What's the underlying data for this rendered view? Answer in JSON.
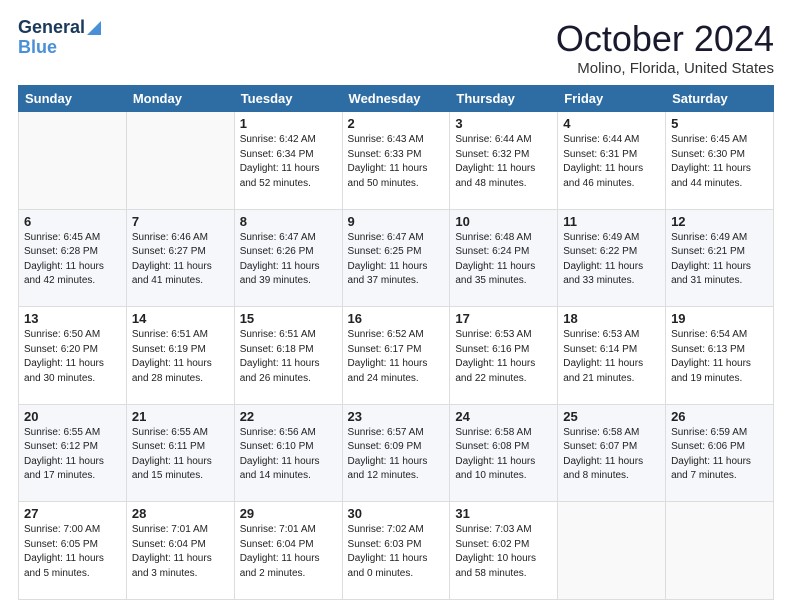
{
  "logo": {
    "line1": "General",
    "line2": "Blue"
  },
  "header": {
    "month": "October 2024",
    "location": "Molino, Florida, United States"
  },
  "weekdays": [
    "Sunday",
    "Monday",
    "Tuesday",
    "Wednesday",
    "Thursday",
    "Friday",
    "Saturday"
  ],
  "weeks": [
    [
      {
        "day": "",
        "info": ""
      },
      {
        "day": "",
        "info": ""
      },
      {
        "day": "1",
        "info": "Sunrise: 6:42 AM\nSunset: 6:34 PM\nDaylight: 11 hours\nand 52 minutes."
      },
      {
        "day": "2",
        "info": "Sunrise: 6:43 AM\nSunset: 6:33 PM\nDaylight: 11 hours\nand 50 minutes."
      },
      {
        "day": "3",
        "info": "Sunrise: 6:44 AM\nSunset: 6:32 PM\nDaylight: 11 hours\nand 48 minutes."
      },
      {
        "day": "4",
        "info": "Sunrise: 6:44 AM\nSunset: 6:31 PM\nDaylight: 11 hours\nand 46 minutes."
      },
      {
        "day": "5",
        "info": "Sunrise: 6:45 AM\nSunset: 6:30 PM\nDaylight: 11 hours\nand 44 minutes."
      }
    ],
    [
      {
        "day": "6",
        "info": "Sunrise: 6:45 AM\nSunset: 6:28 PM\nDaylight: 11 hours\nand 42 minutes."
      },
      {
        "day": "7",
        "info": "Sunrise: 6:46 AM\nSunset: 6:27 PM\nDaylight: 11 hours\nand 41 minutes."
      },
      {
        "day": "8",
        "info": "Sunrise: 6:47 AM\nSunset: 6:26 PM\nDaylight: 11 hours\nand 39 minutes."
      },
      {
        "day": "9",
        "info": "Sunrise: 6:47 AM\nSunset: 6:25 PM\nDaylight: 11 hours\nand 37 minutes."
      },
      {
        "day": "10",
        "info": "Sunrise: 6:48 AM\nSunset: 6:24 PM\nDaylight: 11 hours\nand 35 minutes."
      },
      {
        "day": "11",
        "info": "Sunrise: 6:49 AM\nSunset: 6:22 PM\nDaylight: 11 hours\nand 33 minutes."
      },
      {
        "day": "12",
        "info": "Sunrise: 6:49 AM\nSunset: 6:21 PM\nDaylight: 11 hours\nand 31 minutes."
      }
    ],
    [
      {
        "day": "13",
        "info": "Sunrise: 6:50 AM\nSunset: 6:20 PM\nDaylight: 11 hours\nand 30 minutes."
      },
      {
        "day": "14",
        "info": "Sunrise: 6:51 AM\nSunset: 6:19 PM\nDaylight: 11 hours\nand 28 minutes."
      },
      {
        "day": "15",
        "info": "Sunrise: 6:51 AM\nSunset: 6:18 PM\nDaylight: 11 hours\nand 26 minutes."
      },
      {
        "day": "16",
        "info": "Sunrise: 6:52 AM\nSunset: 6:17 PM\nDaylight: 11 hours\nand 24 minutes."
      },
      {
        "day": "17",
        "info": "Sunrise: 6:53 AM\nSunset: 6:16 PM\nDaylight: 11 hours\nand 22 minutes."
      },
      {
        "day": "18",
        "info": "Sunrise: 6:53 AM\nSunset: 6:14 PM\nDaylight: 11 hours\nand 21 minutes."
      },
      {
        "day": "19",
        "info": "Sunrise: 6:54 AM\nSunset: 6:13 PM\nDaylight: 11 hours\nand 19 minutes."
      }
    ],
    [
      {
        "day": "20",
        "info": "Sunrise: 6:55 AM\nSunset: 6:12 PM\nDaylight: 11 hours\nand 17 minutes."
      },
      {
        "day": "21",
        "info": "Sunrise: 6:55 AM\nSunset: 6:11 PM\nDaylight: 11 hours\nand 15 minutes."
      },
      {
        "day": "22",
        "info": "Sunrise: 6:56 AM\nSunset: 6:10 PM\nDaylight: 11 hours\nand 14 minutes."
      },
      {
        "day": "23",
        "info": "Sunrise: 6:57 AM\nSunset: 6:09 PM\nDaylight: 11 hours\nand 12 minutes."
      },
      {
        "day": "24",
        "info": "Sunrise: 6:58 AM\nSunset: 6:08 PM\nDaylight: 11 hours\nand 10 minutes."
      },
      {
        "day": "25",
        "info": "Sunrise: 6:58 AM\nSunset: 6:07 PM\nDaylight: 11 hours\nand 8 minutes."
      },
      {
        "day": "26",
        "info": "Sunrise: 6:59 AM\nSunset: 6:06 PM\nDaylight: 11 hours\nand 7 minutes."
      }
    ],
    [
      {
        "day": "27",
        "info": "Sunrise: 7:00 AM\nSunset: 6:05 PM\nDaylight: 11 hours\nand 5 minutes."
      },
      {
        "day": "28",
        "info": "Sunrise: 7:01 AM\nSunset: 6:04 PM\nDaylight: 11 hours\nand 3 minutes."
      },
      {
        "day": "29",
        "info": "Sunrise: 7:01 AM\nSunset: 6:04 PM\nDaylight: 11 hours\nand 2 minutes."
      },
      {
        "day": "30",
        "info": "Sunrise: 7:02 AM\nSunset: 6:03 PM\nDaylight: 11 hours\nand 0 minutes."
      },
      {
        "day": "31",
        "info": "Sunrise: 7:03 AM\nSunset: 6:02 PM\nDaylight: 10 hours\nand 58 minutes."
      },
      {
        "day": "",
        "info": ""
      },
      {
        "day": "",
        "info": ""
      }
    ]
  ]
}
